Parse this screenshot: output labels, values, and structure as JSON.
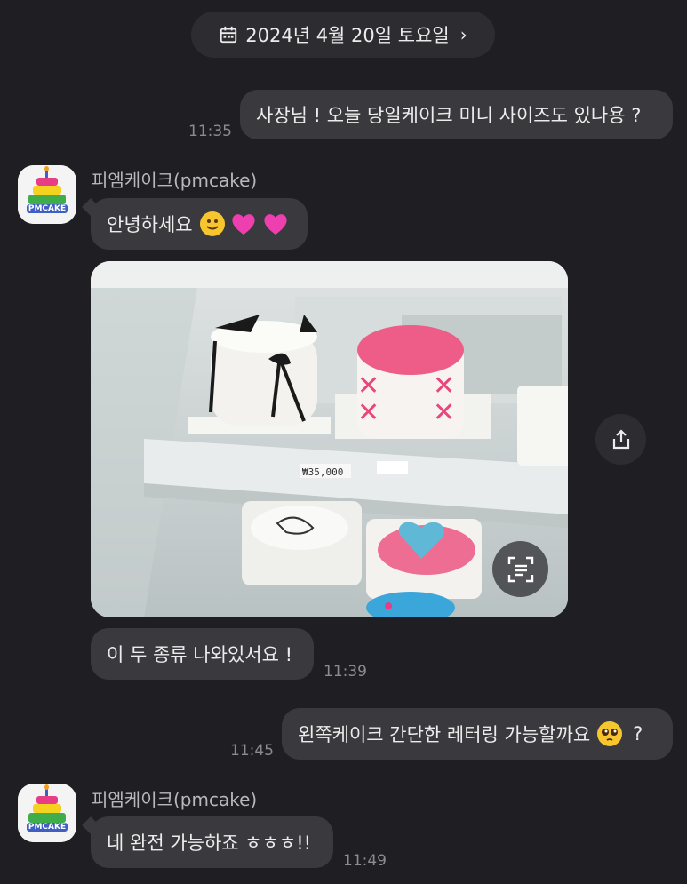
{
  "date_header": {
    "label": "2024년 4월 20일 토요일",
    "chevron": "›",
    "icon": "calendar-icon"
  },
  "messages": [
    {
      "side": "right",
      "text": "사장님 ! 오늘 당일케이크 미니 사이즈도 있나용 ?",
      "time": "11:35"
    },
    {
      "side": "left",
      "sender": "피엠케이크(pmcake)",
      "text": "안녕하세요",
      "emoji": [
        "slight-smile",
        "pink-heart",
        "pink-heart"
      ]
    },
    {
      "side": "left",
      "type": "photo",
      "caption": "₩35,000"
    },
    {
      "side": "left",
      "text": "이 두 종류 나와있서요 !",
      "time": "11:39"
    },
    {
      "side": "right",
      "text": "왼쪽케이크 간단한 레터링 가능할까요",
      "suffix": "?",
      "emoji": [
        "pleading-face"
      ],
      "time": "11:45"
    },
    {
      "side": "left",
      "sender": "피엠케이크(pmcake)",
      "text": "네 완전 가능하죠 ㅎㅎㅎ!!",
      "time": "11:49"
    }
  ],
  "avatar": {
    "brand": "PMCAKE"
  },
  "actions": {
    "share": "share-icon",
    "scan": "text-scan-icon"
  },
  "colors": {
    "background": "#1f1f23",
    "bubble": "#3a3a3e",
    "time": "#8c8c90"
  }
}
